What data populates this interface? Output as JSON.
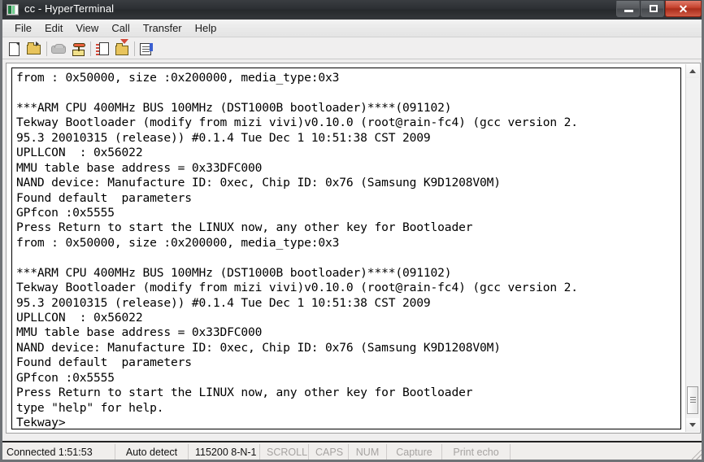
{
  "window": {
    "title": "cc - HyperTerminal",
    "icon": "hyperterminal-icon",
    "controls": {
      "minimize": "Minimize",
      "maximize": "Maximize",
      "close": "Close"
    }
  },
  "menubar": {
    "items": [
      {
        "label": "File"
      },
      {
        "label": "Edit"
      },
      {
        "label": "View"
      },
      {
        "label": "Call"
      },
      {
        "label": "Transfer"
      },
      {
        "label": "Help"
      }
    ]
  },
  "toolbar": {
    "buttons": [
      {
        "name": "new-connection-icon",
        "tooltip": "New"
      },
      {
        "name": "open-icon",
        "tooltip": "Open"
      },
      {
        "name": "disconnect-phone-icon",
        "tooltip": "Disconnect"
      },
      {
        "name": "call-phone-icon",
        "tooltip": "Call"
      },
      {
        "name": "send-file-icon",
        "tooltip": "Send"
      },
      {
        "name": "receive-file-icon",
        "tooltip": "Receive"
      },
      {
        "name": "properties-icon",
        "tooltip": "Properties"
      }
    ]
  },
  "terminal": {
    "lines": [
      "from : 0x50000, size :0x200000, media_type:0x3",
      "",
      "***ARM CPU 400MHz BUS 100MHz (DST1000B bootloader)****(091102)",
      "Tekway Bootloader (modify from mizi vivi)v0.10.0 (root@rain-fc4) (gcc version 2.",
      "95.3 20010315 (release)) #0.1.4 Tue Dec 1 10:51:38 CST 2009",
      "UPLLCON  : 0x56022",
      "MMU table base address = 0x33DFC000",
      "NAND device: Manufacture ID: 0xec, Chip ID: 0x76 (Samsung K9D1208V0M)",
      "Found default  parameters",
      "GPfcon :0x5555",
      "Press Return to start the LINUX now, any other key for Bootloader",
      "from : 0x50000, size :0x200000, media_type:0x3",
      "",
      "***ARM CPU 400MHz BUS 100MHz (DST1000B bootloader)****(091102)",
      "Tekway Bootloader (modify from mizi vivi)v0.10.0 (root@rain-fc4) (gcc version 2.",
      "95.3 20010315 (release)) #0.1.4 Tue Dec 1 10:51:38 CST 2009",
      "UPLLCON  : 0x56022",
      "MMU table base address = 0x33DFC000",
      "NAND device: Manufacture ID: 0xec, Chip ID: 0x76 (Samsung K9D1208V0M)",
      "Found default  parameters",
      "GPfcon :0x5555",
      "Press Return to start the LINUX now, any other key for Bootloader",
      "type \"help\" for help.",
      "Tekway> "
    ],
    "prompt": "Tekway> ",
    "cursor": "_"
  },
  "scrollbar": {
    "up_arrow": "scroll-up",
    "down_arrow": "scroll-down",
    "position": "bottom"
  },
  "statusbar": {
    "connected": "Connected 1:51:53",
    "detect": "Auto detect",
    "settings": "115200 8-N-1",
    "scroll": "SCROLL",
    "caps": "CAPS",
    "num": "NUM",
    "capture": "Capture",
    "print_echo": "Print echo"
  },
  "colors": {
    "titlebar": "#2c2f33",
    "close_button": "#c4412c",
    "terminal_bg": "#ffffff",
    "terminal_fg": "#000000",
    "chrome": "#efeeee"
  }
}
